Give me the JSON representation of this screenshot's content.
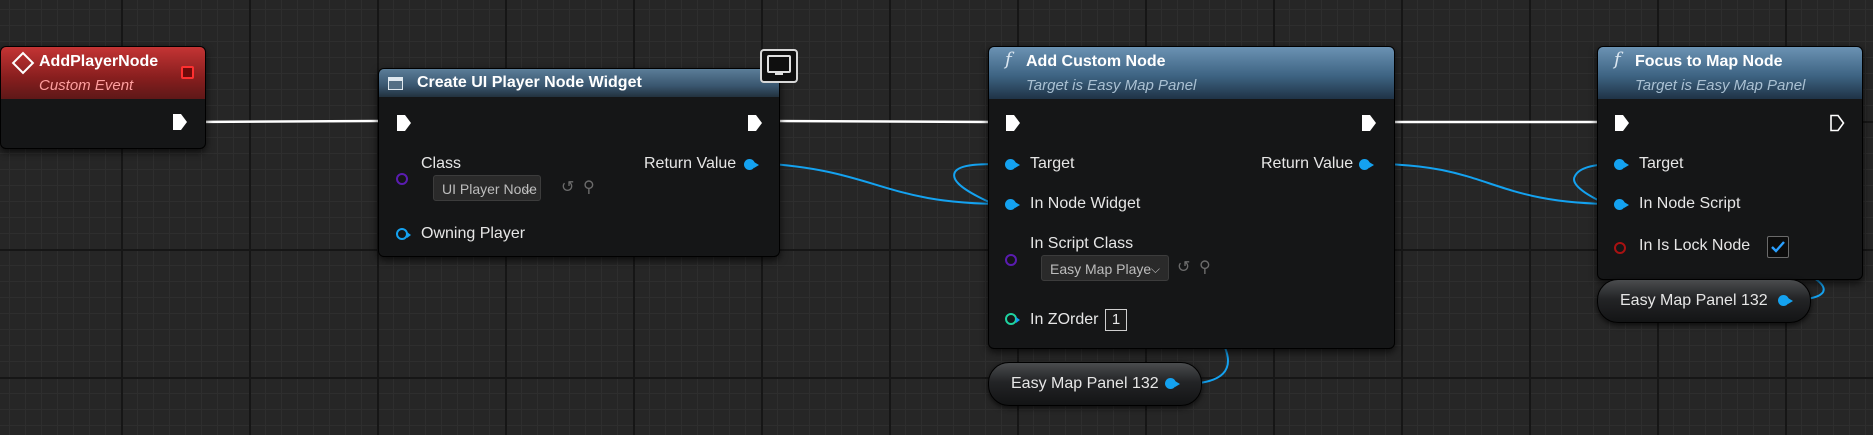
{
  "graph": {
    "nodes": {
      "add_player_node": {
        "title": "AddPlayerNode",
        "subtitle": "Custom Event"
      },
      "create_widget": {
        "title": "Create UI Player Node Widget",
        "class_label": "Class",
        "class_value": "UI Player Node",
        "owning_player_label": "Owning Player",
        "return_value_label": "Return Value"
      },
      "add_custom_node": {
        "icon_glyph": "f",
        "title": "Add Custom Node",
        "subtitle": "Target is Easy Map Panel",
        "target_label": "Target",
        "in_node_widget_label": "In Node Widget",
        "in_script_class_label": "In Script Class",
        "in_script_class_value": "Easy Map Playe",
        "in_zorder_label": "In ZOrder",
        "in_zorder_value": "1",
        "return_value_label": "Return Value"
      },
      "focus_to_map_node": {
        "icon_glyph": "f",
        "title": "Focus to Map Node",
        "subtitle": "Target is Easy Map Panel",
        "target_label": "Target",
        "in_node_script_label": "In Node Script",
        "in_is_lock_node_label": "In Is Lock Node",
        "in_is_lock_node_checked": true
      }
    },
    "variables": {
      "var_bottom": {
        "label": "Easy Map Panel 132"
      },
      "var_right": {
        "label": "Easy Map Panel 132"
      }
    }
  },
  "colors": {
    "exec_wire": "#ffffff",
    "object_pin": "#14a2f0",
    "class_pin": "#5a1cb0",
    "int_pin": "#1fd2a0",
    "bool_pin": "#a81212",
    "event_header": "#a82828",
    "function_header": "#3e6483"
  }
}
